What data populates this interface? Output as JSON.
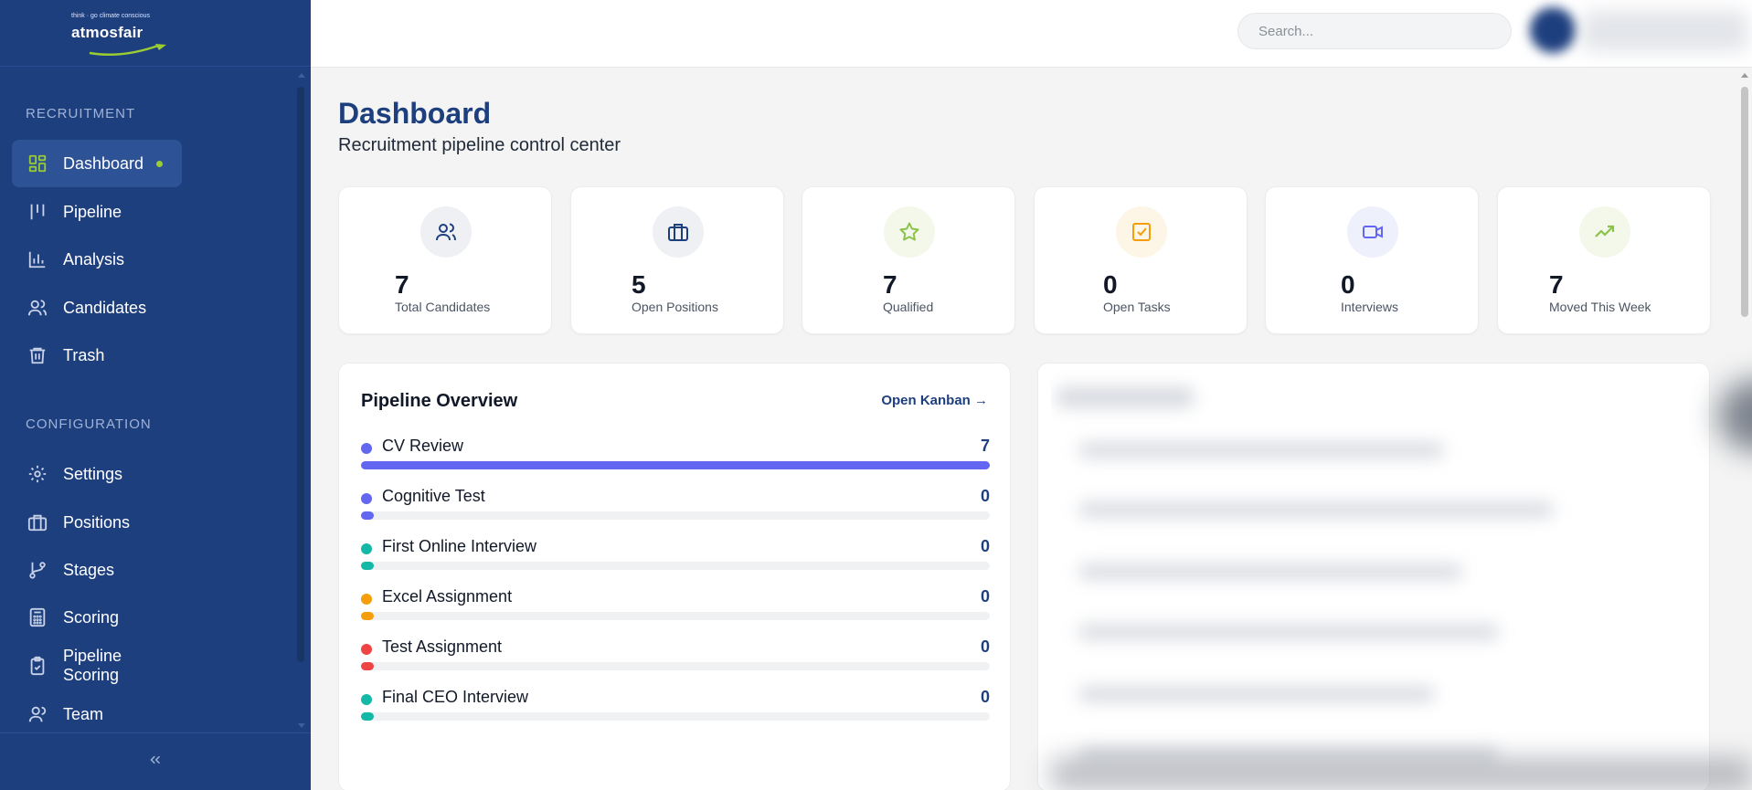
{
  "brand": {
    "tagline": "think · go climate conscious",
    "name": "atmosfair"
  },
  "sidebar": {
    "sections": [
      {
        "title": "RECRUITMENT",
        "items": [
          {
            "label": "Dashboard",
            "icon": "dashboard-grid-icon",
            "active": true
          },
          {
            "label": "Pipeline",
            "icon": "pipeline-icon"
          },
          {
            "label": "Analysis",
            "icon": "bar-chart-icon"
          },
          {
            "label": "Candidates",
            "icon": "users-icon"
          },
          {
            "label": "Trash",
            "icon": "trash-icon"
          }
        ]
      },
      {
        "title": "CONFIGURATION",
        "items": [
          {
            "label": "Settings",
            "icon": "gear-icon"
          },
          {
            "label": "Positions",
            "icon": "briefcase-icon"
          },
          {
            "label": "Stages",
            "icon": "git-branch-icon"
          },
          {
            "label": "Scoring",
            "icon": "calculator-icon"
          },
          {
            "label": "Pipeline Scoring",
            "icon": "clipboard-check-icon"
          },
          {
            "label": "Team",
            "icon": "user-icon"
          }
        ]
      }
    ],
    "collapse_icon": "chevrons-left-icon"
  },
  "search": {
    "placeholder": "Search..."
  },
  "page": {
    "title": "Dashboard",
    "subtitle": "Recruitment pipeline control center"
  },
  "stats": [
    {
      "value": "7",
      "label": "Total Candidates",
      "icon": "users-icon",
      "color": "#1e3f7e",
      "bg": "#eef0f4"
    },
    {
      "value": "5",
      "label": "Open Positions",
      "icon": "briefcase-icon",
      "color": "#1e3f7e",
      "bg": "#eef0f4"
    },
    {
      "value": "7",
      "label": "Qualified",
      "icon": "star-icon",
      "color": "#8bc34a",
      "bg": "#f3f8ea"
    },
    {
      "value": "0",
      "label": "Open Tasks",
      "icon": "checkbox-icon",
      "color": "#f59e0b",
      "bg": "#fdf5e6"
    },
    {
      "value": "0",
      "label": "Interviews",
      "icon": "video-icon",
      "color": "#6366f1",
      "bg": "#eef0fb"
    },
    {
      "value": "7",
      "label": "Moved This Week",
      "icon": "trending-up-icon",
      "color": "#8bc34a",
      "bg": "#f3f8ea"
    }
  ],
  "pipeline": {
    "title": "Pipeline Overview",
    "link": "Open Kanban →",
    "stages": [
      {
        "name": "CV Review",
        "count": "7",
        "fraction": 1.0,
        "color": "#6366f1"
      },
      {
        "name": "Cognitive Test",
        "count": "0",
        "fraction": 0,
        "color": "#6366f1"
      },
      {
        "name": "First Online Interview",
        "count": "0",
        "fraction": 0,
        "color": "#14b8a6"
      },
      {
        "name": "Excel Assignment",
        "count": "0",
        "fraction": 0,
        "color": "#f59e0b"
      },
      {
        "name": "Test Assignment",
        "count": "0",
        "fraction": 0,
        "color": "#ef4444"
      },
      {
        "name": "Final CEO Interview",
        "count": "0",
        "fraction": 0,
        "color": "#14b8a6"
      }
    ]
  }
}
